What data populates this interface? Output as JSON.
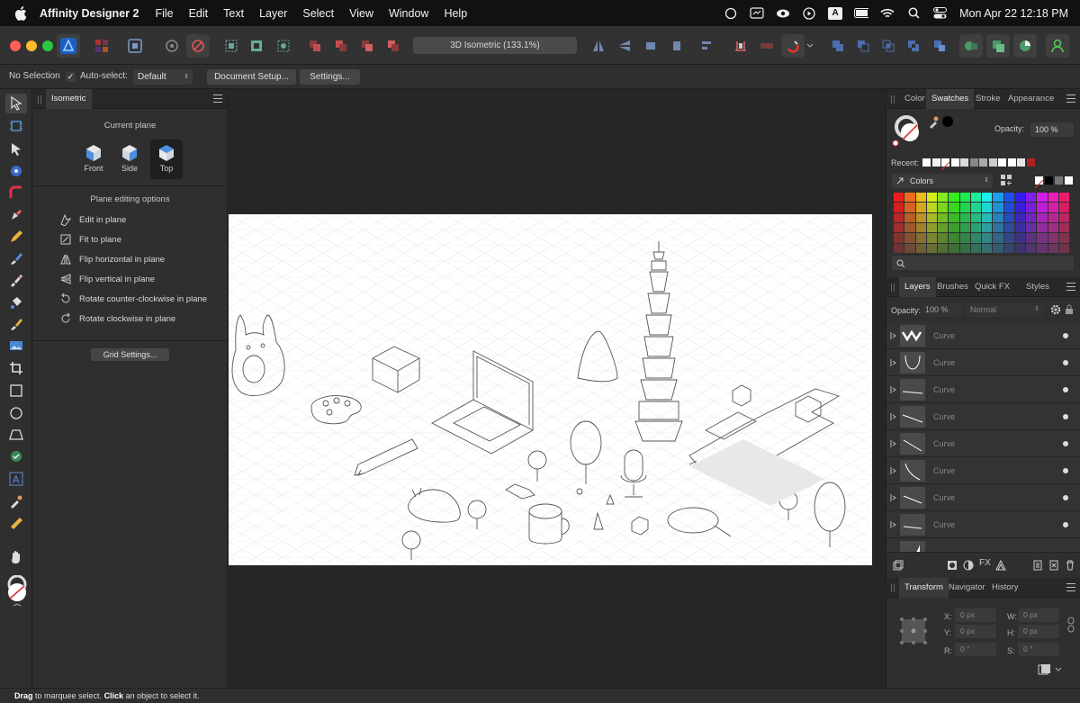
{
  "menubar": {
    "app_name": "Affinity Designer 2",
    "menus": [
      "File",
      "Edit",
      "Text",
      "Layer",
      "Select",
      "View",
      "Window",
      "Help"
    ],
    "clock": "Mon Apr 22  12:18 PM",
    "input_source": "A"
  },
  "toolbar": {
    "zoom_label": "3D Isometric (133.1%)"
  },
  "context_bar": {
    "selection": "No Selection",
    "auto_select_label": "Auto-select:",
    "auto_select_checked": true,
    "auto_select_value": "Default",
    "document_setup": "Document Setup...",
    "settings": "Settings..."
  },
  "isometric_panel": {
    "tab": "Isometric",
    "current_plane_title": "Current plane",
    "planes": [
      {
        "label": "Front",
        "selected": false
      },
      {
        "label": "Side",
        "selected": false
      },
      {
        "label": "Top",
        "selected": true
      }
    ],
    "options_title": "Plane editing options",
    "options": [
      "Edit in plane",
      "Fit to plane",
      "Flip horizontal in plane",
      "Flip vertical in plane",
      "Rotate counter-clockwise in plane",
      "Rotate clockwise in plane"
    ],
    "grid_settings": "Grid Settings..."
  },
  "color_panel": {
    "tabs": [
      "Color",
      "Swatches",
      "Stroke",
      "Appearance"
    ],
    "active_tab": "Swatches",
    "opacity_label": "Opacity:",
    "opacity_value": "100 %",
    "recent_label": "Recent:",
    "palette_name": "Colors",
    "recent_colors": [
      "#ffffff",
      "#f2f2f2",
      "none",
      "#ffffff",
      "#dcdcdc",
      "#888888",
      "#aaaaaa",
      "#cccccc",
      "#ffffff",
      "#ffffff",
      "#e6e6e6",
      "#b02020"
    ]
  },
  "layers_panel": {
    "tabs": [
      "Layers",
      "Brushes",
      "Quick FX",
      "Styles"
    ],
    "active_tab": "Layers",
    "opacity_label": "Opacity:",
    "opacity_value": "100 %",
    "blend_mode": "Normal",
    "layers": [
      "Curve",
      "Curve",
      "Curve",
      "Curve",
      "Curve",
      "Curve",
      "Curve",
      "Curve"
    ]
  },
  "transform_panel": {
    "tabs": [
      "Transform",
      "Navigator",
      "History"
    ],
    "active_tab": "Transform",
    "x_label": "X:",
    "x_value": "0 px",
    "y_label": "Y:",
    "y_value": "0 px",
    "w_label": "W:",
    "w_value": "0 px",
    "h_label": "H:",
    "h_value": "0 px",
    "r_label": "R:",
    "r_value": "0 °",
    "s_label": "S:",
    "s_value": "0 °"
  },
  "status_bar": {
    "drag": "Drag",
    "drag_text": " to marquee select. ",
    "click": "Click",
    "click_text": " an object to select it."
  },
  "colors": {
    "accent": "#2a6fe0",
    "canvas": "#262626",
    "panel": "#2f2f2f"
  }
}
